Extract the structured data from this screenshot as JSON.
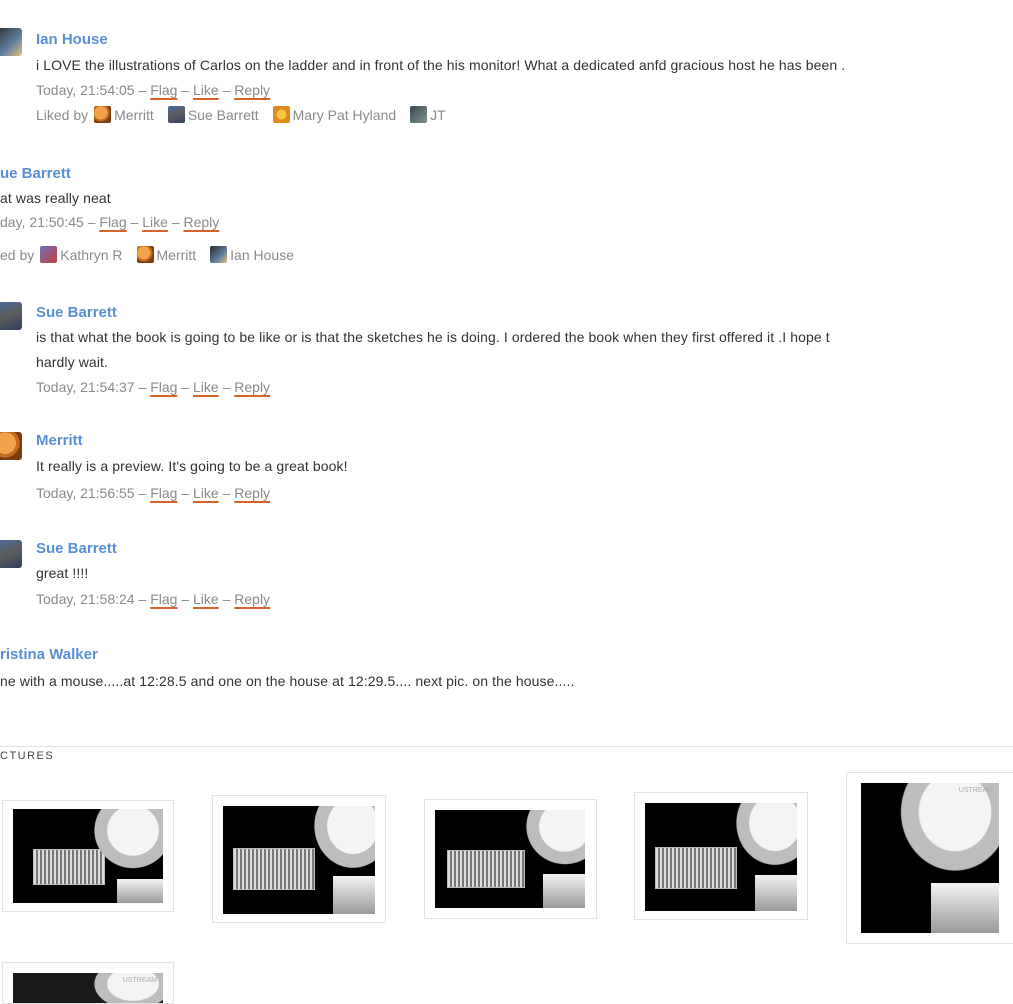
{
  "comments": [
    {
      "author": "Ian House",
      "text": "i LOVE the illustrations of Carlos on the ladder and in front of the his monitor!  What a dedicated anfd gracious host he has been .",
      "timestamp": "Today, 21:54:05",
      "actions": {
        "flag": "Flag",
        "like": "Like",
        "reply": "Reply"
      },
      "liked_by_label": "Liked by",
      "liked_by": [
        "Merritt",
        "Sue Barrett",
        "Mary Pat Hyland",
        "JT"
      ]
    },
    {
      "author": "ue Barrett",
      "text": "at was really neat",
      "timestamp": "day, 21:50:45",
      "actions": {
        "flag": "Flag",
        "like": "Like",
        "reply": "Reply"
      },
      "liked_by_label": "ed by",
      "liked_by": [
        "Kathryn R",
        "Merritt",
        "Ian House"
      ]
    },
    {
      "author": "Sue Barrett",
      "text": "is that what the book is going to be like or is that the sketches he is doing.   I ordered the book when they first offered it .I hope t",
      "text2": "hardly wait.",
      "timestamp": "Today, 21:54:37",
      "actions": {
        "flag": "Flag",
        "like": "Like",
        "reply": "Reply"
      }
    },
    {
      "author": "Merritt",
      "text": "It really is a preview. It's going to be a great book!",
      "timestamp": "Today, 21:56:55",
      "actions": {
        "flag": "Flag",
        "like": "Like",
        "reply": "Reply"
      }
    },
    {
      "author": "Sue Barrett",
      "text": "great !!!!",
      "timestamp": "Today, 21:58:24",
      "actions": {
        "flag": "Flag",
        "like": "Like",
        "reply": "Reply"
      }
    },
    {
      "author": "ristina Walker",
      "text": "ne with a mouse.....at 12:28.5 and one on the house at 12:29.5.... next pic. on the house....."
    }
  ],
  "pictures": {
    "title": "CTURES",
    "watermark": "USTREAM"
  },
  "separator": "–"
}
